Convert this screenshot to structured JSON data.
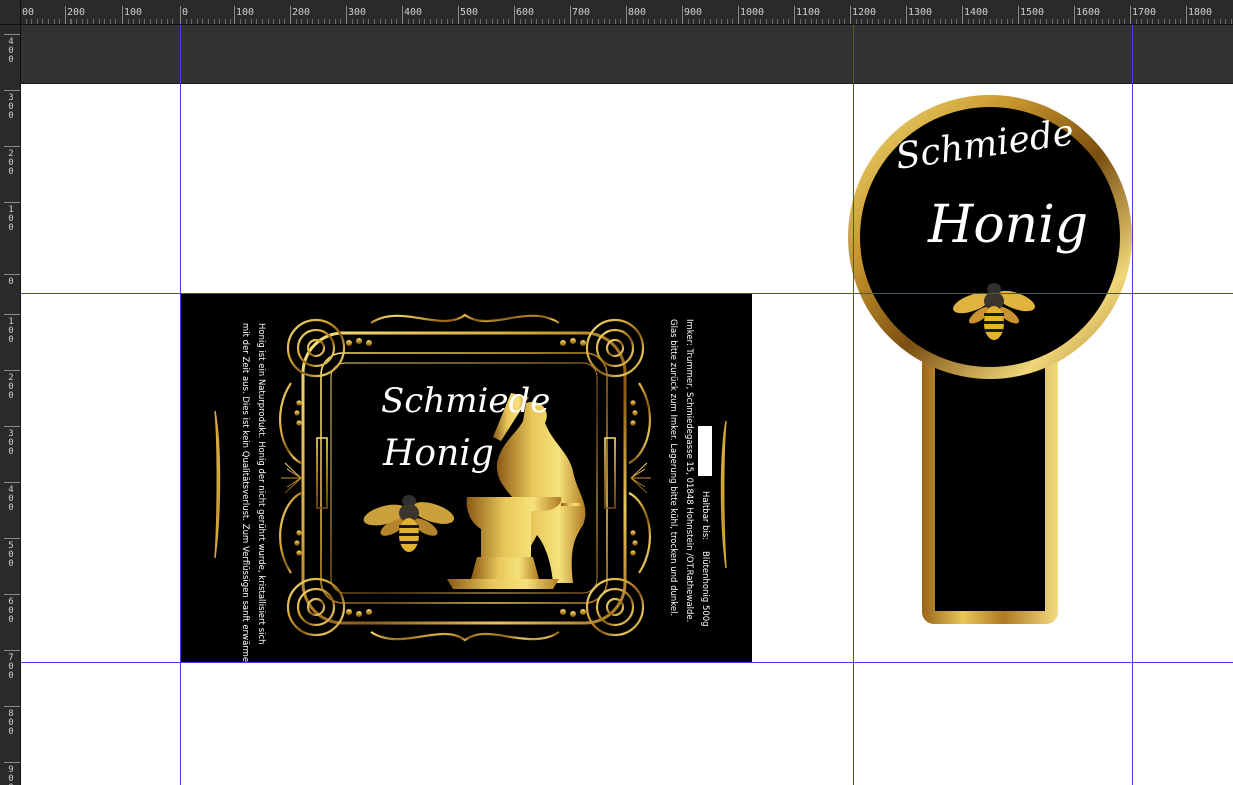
{
  "ruler": {
    "horizontal_labels": [
      "00",
      "200",
      "100",
      "0",
      "100",
      "200",
      "300",
      "400",
      "500",
      "600",
      "700",
      "800",
      "900",
      "1000",
      "1100",
      "1200",
      "1300",
      "1400",
      "1500",
      "1600",
      "1700",
      "1800"
    ],
    "vertical_labels": [
      "400",
      "300",
      "200",
      "100",
      "0",
      "100",
      "200",
      "300",
      "400",
      "500",
      "600",
      "700",
      "800",
      "900"
    ]
  },
  "front_label": {
    "brand_line1": "Schmiede",
    "brand_line2": "Honig",
    "info_left_line1": "Honig ist ein Naturprodukt. Honig der nicht gerührt wurde, kristallisiert sich",
    "info_left_line2": "mit der Zeit aus. Dies ist kein Qualitätsverlust. Zum Verflüssigen sanft erwärmen",
    "info_right_line1": "Glas bitte zurück zum Imker. Lagerung bitte kühl, trocken und dunkel.",
    "info_right_line2": "Imker: Trummer, Schmiedegasse 15, 01848 Hohnstein /OT.Rathewalde.",
    "info_right_line3_product": "Blütenhonig 500g",
    "info_right_line3_expiry": "Haltbar bis:"
  },
  "lid_label": {
    "brand_line1": "Schmiede",
    "brand_line2": "Honig"
  },
  "colors": {
    "gold_light": "#f6e27a",
    "gold_mid": "#d4a73a",
    "gold_dark": "#8a5a14",
    "guide": "#4b3bdc",
    "label_background": "#000000",
    "pasteboard": "#323232",
    "ruler": "#2a2a2a"
  }
}
